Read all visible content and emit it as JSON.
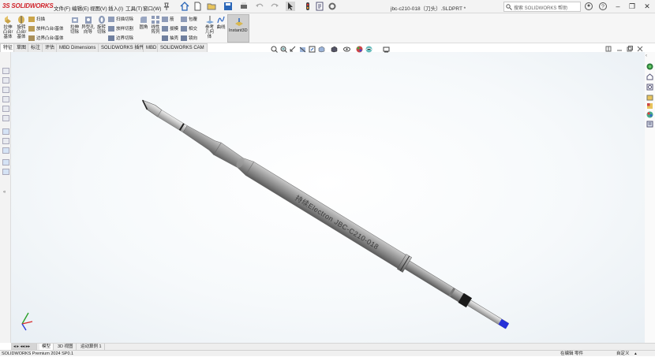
{
  "app": {
    "brand": "SOLIDWORKS",
    "brand_color": "#d0232a"
  },
  "menu": [
    "文件(F)",
    "编辑(E)",
    "视图(V)",
    "插入(I)",
    "工具(T)",
    "窗口(W)"
  ],
  "document_title": "jbc-c210-018（刀头）.SLDPRT *",
  "search": {
    "placeholder": "搜索 SOLIDWORKS 帮助"
  },
  "ribbon": {
    "extrude_boss": "拉伸凸台/基体",
    "revolve_boss": "旋转凸台/基体",
    "sweep": "扫描",
    "loft": "放样凸台/基体",
    "boundary_boss": "边界凸台/基体",
    "extrude_cut": "拉伸切除",
    "hole_wizard": "异型孔向导",
    "revolve_cut": "旋转切除",
    "swept_cut": "扫描切除",
    "lofted_cut": "放样切割",
    "boundary_cut": "边界切除",
    "fillet": "圆角",
    "linear_pattern": "线性阵列",
    "rib": "筋",
    "wrap": "包覆",
    "draft": "拔模",
    "intersect": "相交",
    "shell": "抽壳",
    "mirror": "镜向",
    "reference_geometry": "参考几何体",
    "curves": "曲线",
    "instant3d": "Instant3D"
  },
  "tabs": [
    "特征",
    "草图",
    "标注",
    "评估",
    "MBD Dimensions",
    "SOLIDWORKS 插件",
    "MBD",
    "SOLIDWORKS CAM"
  ],
  "model": {
    "engraving": "持续Electron JBC-C210-018"
  },
  "bottom_tabs": [
    "模型",
    "3D 视图",
    "运动算例 1"
  ],
  "status": {
    "product": "SOLIDWORKS Premium 2024 SP0.1",
    "mode": "在编辑 零件",
    "units": "自定义"
  },
  "colors": {
    "tool_body": "#8e8e8e",
    "tip_blue": "#2530d8",
    "instant3d_bg": "#cfcfcf"
  }
}
